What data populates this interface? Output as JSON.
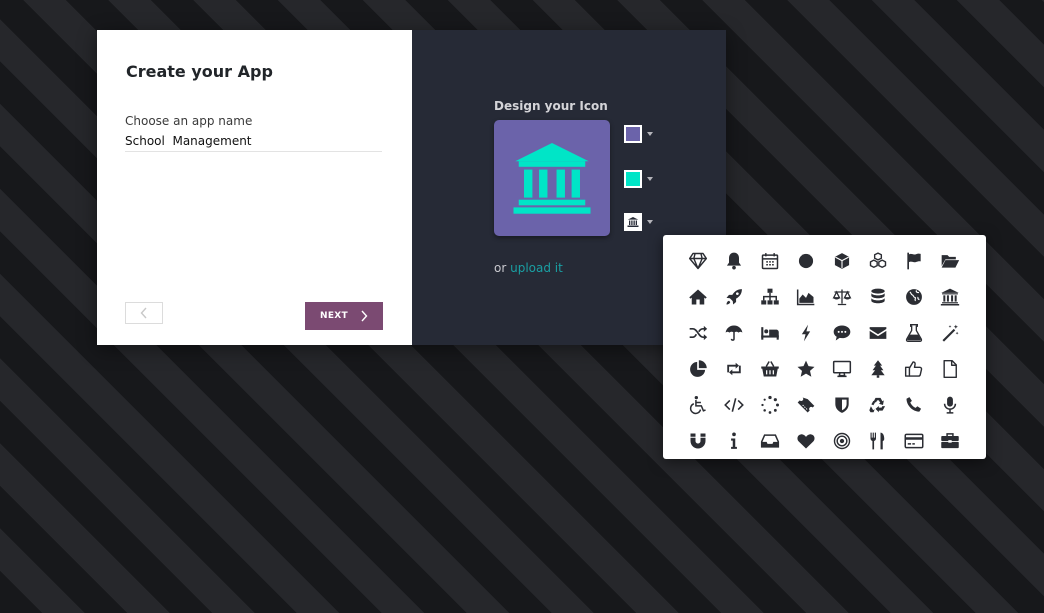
{
  "dialog": {
    "title": "Create your App",
    "name_label": "Choose an app name",
    "name_value": "School  Management",
    "next_label": "NEXT"
  },
  "design": {
    "label": "Design your Icon",
    "background_color": "#6b63aa",
    "icon_color": "#00e5c7",
    "selected_icon": "bank-icon",
    "upload_prefix": "or ",
    "upload_link": "upload it"
  },
  "icon_choices": [
    "diamond-icon",
    "bell-icon",
    "calendar-icon",
    "circle-icon",
    "cube-icon",
    "cubes-icon",
    "flag-icon",
    "folder-open-icon",
    "home-icon",
    "rocket-icon",
    "sitemap-icon",
    "area-chart-icon",
    "balance-scale-icon",
    "database-icon",
    "globe-icon",
    "bank-icon",
    "random-icon",
    "umbrella-icon",
    "bed-icon",
    "bolt-icon",
    "comment-icon",
    "envelope-icon",
    "flask-icon",
    "magic-icon",
    "pie-chart-icon",
    "retweet-icon",
    "shopping-basket-icon",
    "star-icon",
    "desktop-icon",
    "tree-icon",
    "thumbs-up-icon",
    "file-icon",
    "wheelchair-icon",
    "code-icon",
    "spinner-icon",
    "ticket-icon",
    "shield-icon",
    "recycle-icon",
    "phone-icon",
    "microphone-icon",
    "magnet-icon",
    "info-icon",
    "inbox-icon",
    "heart-icon",
    "bullseye-icon",
    "cutlery-icon",
    "credit-card-icon",
    "briefcase-icon"
  ]
}
